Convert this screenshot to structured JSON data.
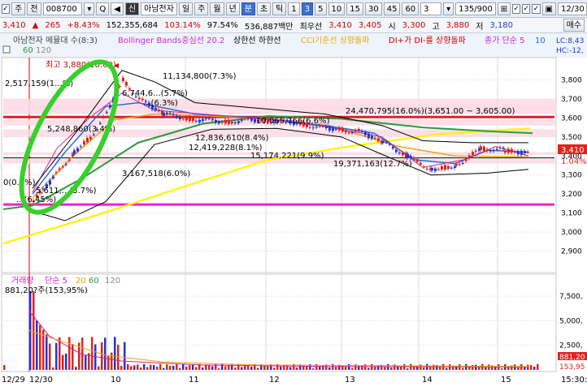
{
  "toolbar": {
    "checkbox1": "✓",
    "type": "주",
    "kind": "전",
    "code": "008700",
    "icon_q": "Q",
    "nav_prev": "◀",
    "badge": "신",
    "stock_name": "아남전자",
    "periods": [
      "일",
      "주",
      "월",
      "년",
      "분",
      "초",
      "틱"
    ],
    "selected_period": "분",
    "numbers": [
      "1",
      "3",
      "5",
      "10",
      "15",
      "30",
      "45",
      "60"
    ],
    "selected_number": "3",
    "interval": "3",
    "count": "135/900",
    "right_date": "12/30"
  },
  "info": {
    "price": "3,410",
    "change": "▲",
    "change_val": "265",
    "change_pct": "+8.43%",
    "volume": "152,355,684",
    "vol_pct": "103.14%",
    "ratio": "97.54%",
    "amount": "536,887백만",
    "best_label": "최우선",
    "ask": "3,410",
    "bid": "3,405",
    "open_label": "시",
    "open": "3,300",
    "high_label": "고",
    "high": "3,880",
    "low_label": "저",
    "low": "3,180",
    "buy_label": "매수",
    "buy_label2": "매수"
  },
  "legend": {
    "title": "아남전자 메뮬대 수(8:3)",
    "bollinger": "Bollinger Bands중심선 20.2",
    "upper": "상한선",
    "lower": "하한선",
    "cci": "CCI기준선 상향돌파",
    "di": "DI+가 DI-를 상향돌파",
    "close": "종가 단순 5",
    "ten": "10",
    "sixty": "60",
    "one_twenty": "120",
    "lc": "LC:8,43",
    "hc": "HC:-12,"
  },
  "annotations": {
    "max_label": "최고 3,880(10:09)",
    "a1": "2,517,159(1...%)",
    "a2": "5,248,860(3.4%)",
    "a3": "0(0.0%)",
    "a4": "11,134,800(7.3%)",
    "a5": "6,744,6...(5.7%)",
    "a6": "...(6.3%)",
    "a7": "10,065,766(6.6%)",
    "a8": "24,470,795(16.0%)(3,651.00 ~ 3,605.00)",
    "a9": "12,836,610(8.4%)",
    "a10": "12,419,228(8.1%)",
    "a11": "15,174,221(9.9%)",
    "a12": "19,371,163(12.7%)",
    "a13": "3,167,518(6.0%)",
    "a14": "5,611,...(3.7%)",
    "a15": "...(6.45%)",
    "price_box": "3,410",
    "price_pct": "1.04%"
  },
  "volume": {
    "title": "거래량",
    "ma_label": "단순 5",
    "ma20": "20",
    "ma60": "60",
    "ma120": "120",
    "vol_text": "881,20?주(153,95%)",
    "right_val": "881,20",
    "right_pct": "153,95"
  },
  "time_axis": [
    "12/29",
    "12/30",
    "10",
    "11",
    "12",
    "13",
    "14",
    "15",
    "15:30:0"
  ],
  "chart_data": [
    {
      "type": "candlestick",
      "title": "아남전자 메뮬대 수(8:3)",
      "ylim": [
        2800,
        3900
      ],
      "y_ticks": [
        2900,
        3000,
        3100,
        3200,
        3300,
        3400,
        3500,
        3600,
        3700,
        3800
      ],
      "x": [
        "12/29",
        "12/30",
        "10",
        "11",
        "12",
        "13",
        "14",
        "15"
      ],
      "close": [
        3150,
        3180,
        3700,
        3560,
        3550,
        3420,
        3330,
        3420
      ],
      "high": [
        3180,
        3320,
        3880,
        3640,
        3610,
        3530,
        3420,
        3470
      ],
      "low": [
        3100,
        3140,
        3280,
        3500,
        3480,
        3380,
        3300,
        3360
      ],
      "horizontal_lines": [
        3605,
        3145,
        3390
      ],
      "price_levels_labeled": [
        "3,410"
      ]
    },
    {
      "type": "bar",
      "title": "거래량",
      "ylim": [
        0,
        8500000
      ],
      "y_ticks": [
        2500000,
        5000000,
        7500000
      ],
      "tick_labels": [
        "2,500,",
        "5,000,",
        "7,500,"
      ],
      "values": [
        500000,
        8000000,
        6000000,
        3200000,
        1800000,
        900000,
        700000,
        400000,
        300000,
        250000,
        200000,
        180000,
        160000,
        170000,
        300000,
        250000,
        200000
      ]
    }
  ],
  "colors": {
    "up": "#e0221f",
    "down": "#1f35d4",
    "ma5": "#d5257f",
    "ma10": "#1f6fe0",
    "ma20": "#f0a21c",
    "ma60": "#2e9a3e",
    "ma120": "#c7c7c7",
    "bollinger": "#000000",
    "highlight_oval": "#38d02a",
    "line_red": "#e01e2a",
    "line_magenta": "#f21ed8",
    "trend_yellow": "#fff21a"
  },
  "right_axis_buttons": [
    "매수"
  ]
}
